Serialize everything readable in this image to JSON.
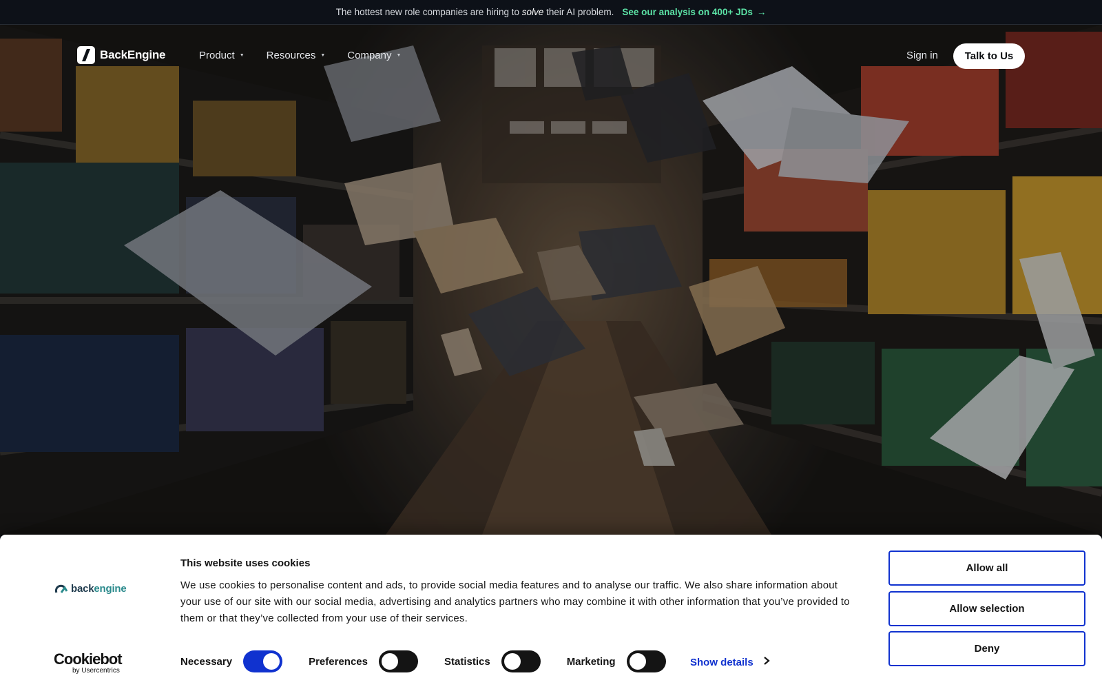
{
  "announcement": {
    "lead_before": "The hottest new role companies are hiring to",
    "lead_italic": "solve",
    "lead_after": "their AI problem.",
    "cta": "See our analysis on 400+ JDs",
    "cta_arrow": "→",
    "accent_color": "#5ce3a6"
  },
  "nav": {
    "brand": "BackEngine",
    "brand_icon": "slash-logo-icon",
    "menu": [
      {
        "label": "Product"
      },
      {
        "label": "Resources"
      },
      {
        "label": "Company"
      }
    ],
    "sign_in": "Sign in",
    "cta": "Talk to Us"
  },
  "hero": {
    "image": "archive-shelves-flying-papers"
  },
  "cookie_banner": {
    "logo_text_a": "back",
    "logo_text_b": "engine",
    "title": "This website uses cookies",
    "body": "We use cookies to personalise content and ads, to provide social media features and to analyse our traffic. We also share information about your use of our site with our social media, advertising and analytics partners who may combine it with other information that you’ve provided to them or that they’ve collected from your use of their services.",
    "toggles": [
      {
        "label": "Necessary",
        "on": true
      },
      {
        "label": "Preferences",
        "on": false
      },
      {
        "label": "Statistics",
        "on": false
      },
      {
        "label": "Marketing",
        "on": false
      }
    ],
    "show_details": "Show details",
    "buttons": {
      "allow_all": "Allow all",
      "allow_selection": "Allow selection",
      "deny": "Deny"
    },
    "provider": "Cookiebot",
    "provider_sub": "by Usercentrics",
    "accent_color": "#1032cf"
  }
}
